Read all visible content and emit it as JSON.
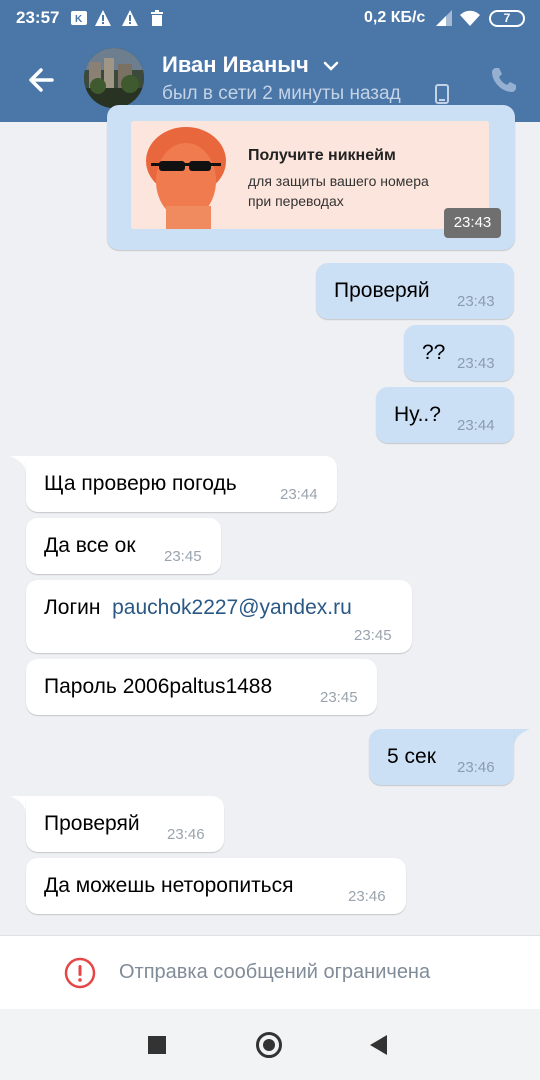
{
  "status_bar": {
    "time": "23:57",
    "network_speed": "0,2 КБ/с",
    "battery": "7"
  },
  "header": {
    "contact_name": "Иван Иваныч",
    "last_seen": "был в сети 2 минуты назад"
  },
  "promo": {
    "title": "Получите никнейм",
    "line1": "для защиты вашего номера",
    "line2": "при переводах",
    "time": "23:43"
  },
  "messages": [
    {
      "dir": "out",
      "text": "Проверяй",
      "time": "23:43"
    },
    {
      "dir": "out",
      "text": "??",
      "time": "23:43"
    },
    {
      "dir": "out",
      "text": "Ну..?",
      "time": "23:44"
    },
    {
      "dir": "in",
      "text": "Ща проверю погодь",
      "time": "23:44"
    },
    {
      "dir": "in",
      "text": "Да все ок",
      "time": "23:45"
    },
    {
      "dir": "in",
      "label": "Логин",
      "link": "pauchok2227@yandex.ru",
      "time": "23:45"
    },
    {
      "dir": "in",
      "text": "Пароль 2006paltus1488",
      "time": "23:45"
    },
    {
      "dir": "out",
      "text": "5 сек",
      "time": "23:46"
    },
    {
      "dir": "in",
      "text": "Проверяй",
      "time": "23:46"
    },
    {
      "dir": "in",
      "text": "Да можешь неторопиться",
      "time": "23:46"
    }
  ],
  "restriction": {
    "text": "Отправка сообщений ограничена"
  },
  "colors": {
    "header_blue": "#4a76a8",
    "outgoing_bubble": "#cce0f5",
    "incoming_bubble": "#ffffff",
    "chat_background": "#eef0f3",
    "link": "#2a5885",
    "warning_red": "#e64646"
  },
  "icons": [
    "back-arrow-icon",
    "chevron-down-icon",
    "mobile-phone-icon",
    "call-icon",
    "warning-icon",
    "wifi-icon",
    "signal-icon",
    "battery-icon",
    "trash-icon",
    "alert-icon",
    "nav-recents-icon",
    "nav-home-icon",
    "nav-back-icon"
  ]
}
